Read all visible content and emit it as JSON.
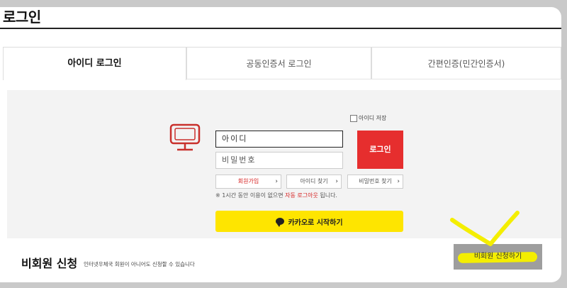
{
  "page": {
    "title": "로그인"
  },
  "tabs": [
    {
      "label": "아이디 로그인",
      "active": true
    },
    {
      "label": "공동인증서 로그인",
      "active": false
    },
    {
      "label": "간편인증(민간인증서)",
      "active": false
    }
  ],
  "login": {
    "remember_label": "아이디 저장",
    "id_value": "아이디",
    "pw_placeholder": "비밀번호",
    "login_button": "로그인",
    "links": [
      {
        "label": "회원가입",
        "color": "red"
      },
      {
        "label": "아이디 찾기"
      },
      {
        "label": "비밀번호 찾기"
      }
    ],
    "notice_prefix": "※ 1시간 동안 이용이 없으면 ",
    "notice_highlight": "자동 로그아웃",
    "notice_suffix": " 됩니다.",
    "kakao_button": "카카오로 시작하기"
  },
  "guest": {
    "title": "비회원 신청",
    "description": "인터넷우체국 회원이 아니어도 신청할 수 있습니다",
    "button": "비회원 신청하기"
  },
  "colors": {
    "login_red": "#e62e2e",
    "kakao_yellow": "#fee500",
    "annotation_yellow": "#f4ee00"
  },
  "icons": {
    "monitor": "monitor-icon",
    "chevron": "chevron-right-icon",
    "kakao": "chat-bubble-icon"
  }
}
